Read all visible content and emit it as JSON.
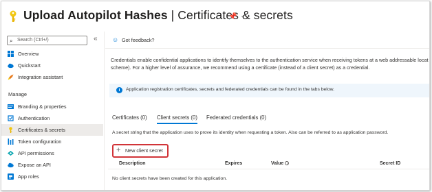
{
  "header": {
    "app_name": "Upload Autopilot Hashes",
    "separator": " | ",
    "page_name": "Certificates & secrets"
  },
  "sidebar": {
    "search_placeholder": "Search (Ctrl+/)",
    "collapse_glyph": "«",
    "items_top": [
      {
        "label": "Overview",
        "icon": "grid-icon"
      },
      {
        "label": "Quickstart",
        "icon": "cloud-icon"
      },
      {
        "label": "Integration assistant",
        "icon": "rocket-icon"
      }
    ],
    "section_manage": "Manage",
    "items_manage": [
      {
        "label": "Branding & properties",
        "icon": "branding-icon"
      },
      {
        "label": "Authentication",
        "icon": "auth-icon"
      },
      {
        "label": "Certificates & secrets",
        "icon": "key-icon",
        "active": true
      },
      {
        "label": "Token configuration",
        "icon": "token-icon"
      },
      {
        "label": "API permissions",
        "icon": "api-icon"
      },
      {
        "label": "Expose an API",
        "icon": "cloud-icon"
      },
      {
        "label": "App roles",
        "icon": "roles-icon"
      }
    ]
  },
  "main": {
    "feedback_label": "Got feedback?",
    "description": "Credentials enable confidential applications to identify themselves to the authentication service when receiving tokens at a web addressable locat scheme). For a higher level of assurance, we recommend using a certificate (instead of a client secret) as a credential.",
    "description_line1": "Credentials enable confidential applications to identify themselves to the authentication service when receiving tokens at a web addressable locat",
    "description_line2": "scheme). For a higher level of assurance, we recommend using a certificate (instead of a client secret) as a credential.",
    "info_text": "Application registration certificates, secrets and federated credentials can be found in the tabs below.",
    "tabs": [
      {
        "label": "Certificates (0)"
      },
      {
        "label": "Client secrets (0)",
        "active": true
      },
      {
        "label": "Federated credentials (0)"
      }
    ],
    "tab_description": "A secret string that the application uses to prove its identity when requesting a token. Also can be referred to as application password.",
    "new_secret_label": "New client secret",
    "columns": [
      "Description",
      "Expires",
      "Value",
      "Secret ID"
    ],
    "empty_message": "No client secrets have been created for this application."
  },
  "colors": {
    "accent": "#0078d4",
    "highlight_border": "#d13438",
    "key_icon": "#f2c811"
  }
}
